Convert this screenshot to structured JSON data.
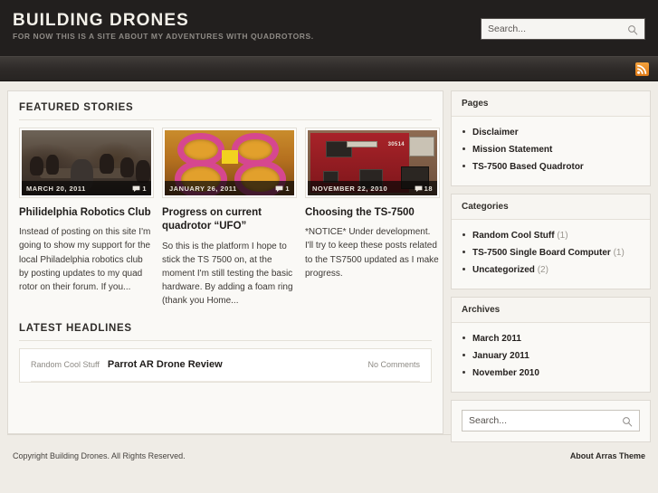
{
  "header": {
    "title": "BUILDING DRONES",
    "tagline": "FOR NOW THIS IS A SITE ABOUT MY ADVENTURES WITH QUADROTORS.",
    "search_placeholder": "Search...",
    "search_value": "",
    "search_icon": "magnifier-icon"
  },
  "navbar": {
    "rss_icon": "rss-feed-icon",
    "rss_color": "#e07b18"
  },
  "main": {
    "featured_heading": "FEATURED STORIES",
    "features": [
      {
        "date": "MARCH 20, 2011",
        "comment_count": "1",
        "title": "Philidelphia Robotics Club",
        "excerpt": "Instead of posting on this site I'm going to show my support for the local Philadelphia robotics club by posting updates to my quad rotor on their forum. If you...",
        "thumb_alt": "people seated around tables at a robotics club meeting"
      },
      {
        "date": "JANUARY 26, 2011",
        "comment_count": "1",
        "title": "Progress on current quadrotor “UFO”",
        "excerpt": "So this is the platform I hope to stick the TS 7500 on, at the moment I'm still testing the basic hardware.  By adding a foam ring (thank you Home...",
        "thumb_alt": "pink foam-ringed quadrotor on an orange workbench"
      },
      {
        "date": "NOVEMBER 22, 2010",
        "comment_count": "18",
        "title": "Choosing the TS-7500",
        "excerpt": "*NOTICE* Under development. I'll try to keep these posts related to the TS7500 updated as I make progress.",
        "thumb_alt": "red TS-7500 single board computer circuit board",
        "thumb_label": "30514"
      }
    ],
    "headlines_heading": "LATEST HEADLINES",
    "headlines": [
      {
        "category": "Random Cool Stuff",
        "title": "Parrot AR Drone Review",
        "comments": "No Comments"
      }
    ]
  },
  "sidebar": {
    "widgets": [
      {
        "heading": "Pages",
        "items": [
          {
            "label": "Disclaimer",
            "count": ""
          },
          {
            "label": "Mission Statement",
            "count": ""
          },
          {
            "label": "TS-7500 Based Quadrotor",
            "count": ""
          }
        ]
      },
      {
        "heading": "Categories",
        "items": [
          {
            "label": "Random Cool Stuff",
            "count": "(1)"
          },
          {
            "label": "TS-7500 Single Board Computer",
            "count": "(1)"
          },
          {
            "label": "Uncategorized",
            "count": "(2)"
          }
        ]
      },
      {
        "heading": "Archives",
        "items": [
          {
            "label": "March 2011",
            "count": ""
          },
          {
            "label": "January 2011",
            "count": ""
          },
          {
            "label": "November 2010",
            "count": ""
          }
        ]
      }
    ],
    "search_placeholder": "Search...",
    "search_value": "",
    "search_icon": "magnifier-icon"
  },
  "footer": {
    "copyright": "Copyright Building Drones. All Rights Reserved.",
    "theme_link": "About Arras Theme"
  }
}
